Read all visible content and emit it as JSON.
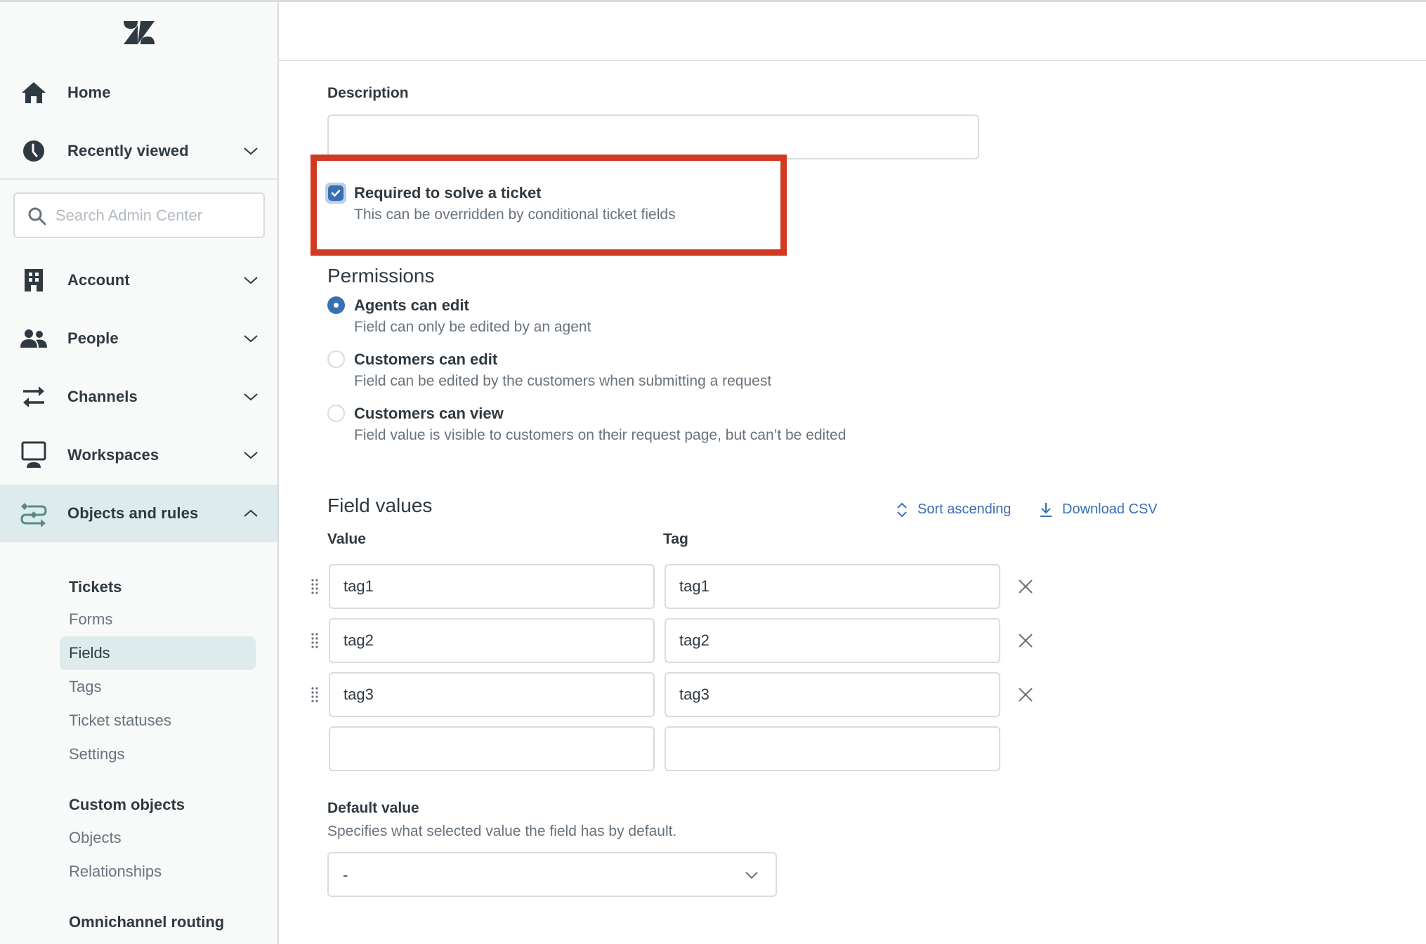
{
  "sidebar": {
    "logo": "zendesk-logo",
    "search_placeholder": "Search Admin Center",
    "nav": [
      {
        "label": "Home",
        "icon": "home-icon",
        "expandable": false
      },
      {
        "label": "Recently viewed",
        "icon": "clock-icon",
        "expandable": true,
        "expanded": false
      },
      {
        "label": "Account",
        "icon": "building-icon",
        "expandable": true,
        "expanded": false
      },
      {
        "label": "People",
        "icon": "people-icon",
        "expandable": true,
        "expanded": false
      },
      {
        "label": "Channels",
        "icon": "arrows-swap-icon",
        "expandable": true,
        "expanded": false
      },
      {
        "label": "Workspaces",
        "icon": "monitor-icon",
        "expandable": true,
        "expanded": false
      },
      {
        "label": "Objects and rules",
        "icon": "objects-rules-icon",
        "expandable": true,
        "expanded": true,
        "active": true
      }
    ],
    "objects_and_rules": {
      "groups": [
        {
          "heading": "Tickets",
          "items": [
            "Forms",
            "Fields",
            "Tags",
            "Ticket statuses",
            "Settings"
          ],
          "selected": "Fields"
        },
        {
          "heading": "Custom objects",
          "items": [
            "Objects",
            "Relationships"
          ]
        },
        {
          "heading": "Omnichannel routing",
          "items": []
        }
      ]
    }
  },
  "form": {
    "description": {
      "label": "Description",
      "value": ""
    },
    "required": {
      "label": "Required to solve a ticket",
      "hint": "This can be overridden by conditional ticket fields",
      "checked": true
    },
    "permissions": {
      "title": "Permissions",
      "options": [
        {
          "label": "Agents can edit",
          "hint": "Field can only be edited by an agent",
          "checked": true
        },
        {
          "label": "Customers can edit",
          "hint": "Field can be edited by the customers when submitting a request",
          "checked": false
        },
        {
          "label": "Customers can view",
          "hint": "Field value is visible to customers on their request page, but can’t be edited",
          "checked": false
        }
      ]
    },
    "field_values": {
      "title": "Field values",
      "sort_label": "Sort ascending",
      "download_label": "Download CSV",
      "columns": [
        "Value",
        "Tag"
      ],
      "rows": [
        {
          "value": "tag1",
          "tag": "tag1"
        },
        {
          "value": "tag2",
          "tag": "tag2"
        },
        {
          "value": "tag3",
          "tag": "tag3"
        },
        {
          "value": "",
          "tag": ""
        }
      ]
    },
    "default_value": {
      "label": "Default value",
      "hint": "Specifies what selected value the field has by default.",
      "selected": "-"
    }
  },
  "colors": {
    "accent": "#3a6fb3",
    "highlight_box": "#d03a22",
    "sidebar_bg": "#f8f9f9",
    "active_bg": "#deebed",
    "objects_icon": "#5a8a88"
  }
}
